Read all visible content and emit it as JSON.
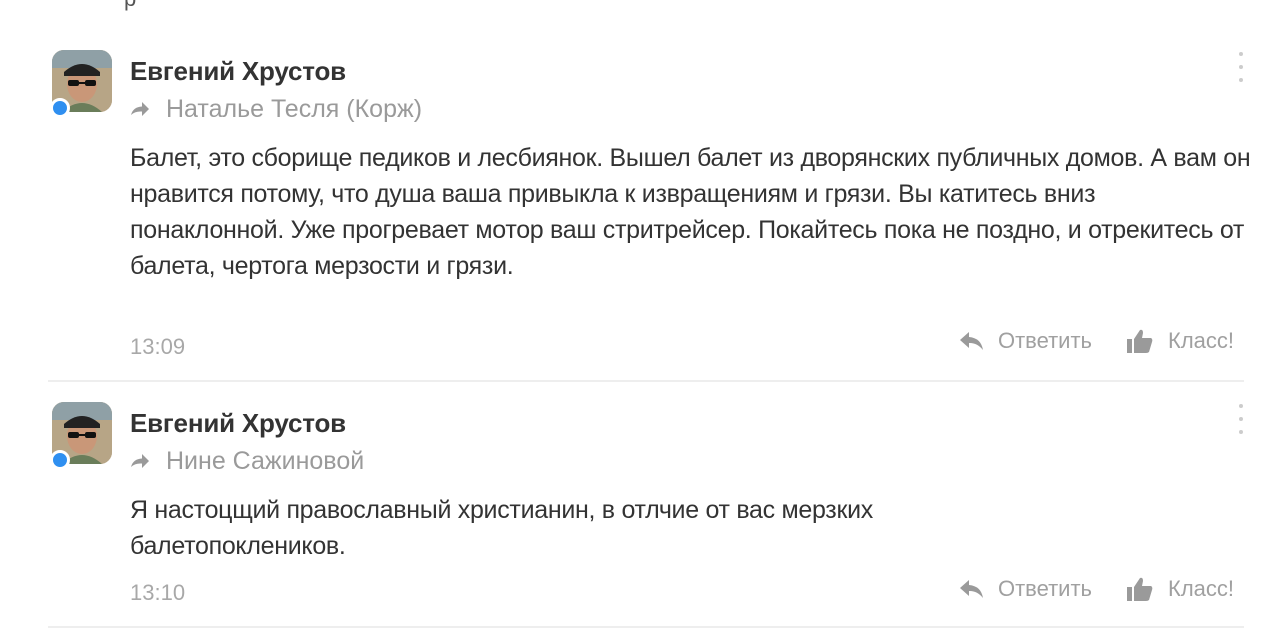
{
  "header": {
    "partial_text": "р"
  },
  "comments": [
    {
      "author": "Евгений Хрустов",
      "reply_to": "Наталье Тесля (Корж)",
      "text": "Балет, это сборище педиков и лесбиянок. Вышел балет из дворянских публичных домов. А вам он нравится потому, что душа ваша привыкла к извращениям и грязи. Вы катитесь вниз понаклонной. Уже прогревает мотор ваш стритрейсер. Покайтесь пока не поздно, и отрекитесь от балета, чертога мерзости и грязи.",
      "time": "13:09",
      "reply_label": "Ответить",
      "like_label": "Класс!"
    },
    {
      "author": "Евгений Хрустов",
      "reply_to": "Нине Сажиновой",
      "text": "Я настоцщий православный христианин, в отлчие от вас мерзких балетопоклеников.",
      "time": "13:10",
      "reply_label": "Ответить",
      "like_label": "Класс!"
    }
  ],
  "icons": {
    "reply_arrow": "reply-arrow-icon",
    "reply": "reply-icon",
    "like": "thumbs-up-icon",
    "menu": "vertical-dots-icon"
  },
  "colors": {
    "online": "#2f8ff0",
    "muted": "#a0a0a0",
    "text": "#333333"
  }
}
